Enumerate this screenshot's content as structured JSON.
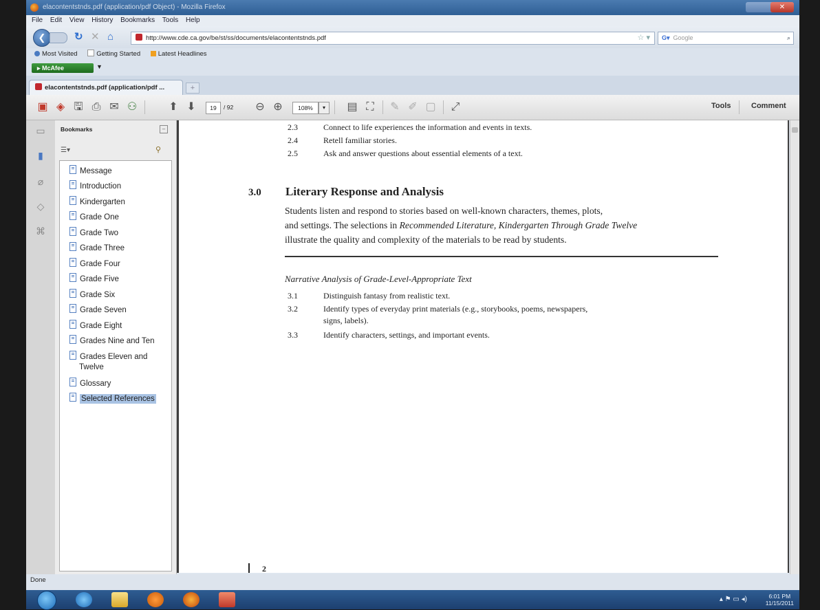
{
  "window": {
    "title": "elacontentstnds.pdf (application/pdf Object) - Mozilla Firefox"
  },
  "menu": [
    "File",
    "Edit",
    "View",
    "History",
    "Bookmarks",
    "Tools",
    "Help"
  ],
  "nav": {
    "url": "http://www.cde.ca.gov/be/st/ss/documents/elacontentstnds.pdf",
    "search_placeholder": "Google"
  },
  "bookmarks_bar": [
    "Most Visited",
    "Getting Started",
    "Latest Headlines"
  ],
  "addon": {
    "label": "McAfee"
  },
  "tab": {
    "label": "elacontentstnds.pdf (application/pdf ..."
  },
  "pdf_toolbar": {
    "page_current": "19",
    "page_total": "/ 92",
    "zoom": "108%",
    "tools_label": "Tools",
    "comment_label": "Comment"
  },
  "bookmarks_panel": {
    "title": "Bookmarks",
    "items": [
      "Message",
      "Introduction",
      "Kindergarten",
      "Grade One",
      "Grade Two",
      "Grade Three",
      "Grade Four",
      "Grade Five",
      "Grade Six",
      "Grade Seven",
      "Grade Eight",
      "Grades Nine and Ten",
      "Grades Eleven and",
      "Twelve",
      "Glossary",
      "Selected References"
    ],
    "selected": "Selected References"
  },
  "document": {
    "top_items": [
      {
        "num": "2.3",
        "text": "Connect to life experiences the information and events in texts."
      },
      {
        "num": "2.4",
        "text": "Retell familiar stories."
      },
      {
        "num": "2.5",
        "text": "Ask and answer questions about essential elements of a text."
      }
    ],
    "section_number": "3.0",
    "section_title": "Literary Response and Analysis",
    "section_body_1": "Students listen and respond to stories based on well-known characters, themes, plots,",
    "section_body_2a": "and settings. The selections in ",
    "section_body_2b": "Recommended Literature, Kindergarten Through Grade Twelve",
    "section_body_3": "illustrate the quality and complexity of the materials to be read by students.",
    "subheading": "Narrative Analysis of Grade-Level-Appropriate Text",
    "items": [
      {
        "num": "3.1",
        "text": "Distinguish fantasy from realistic text."
      },
      {
        "num": "3.2",
        "text": "Identify types of everyday print materials (e.g., storybooks, poems, newspapers,"
      },
      {
        "num": "",
        "text": "signs, labels)."
      },
      {
        "num": "3.3",
        "text": "Identify characters, settings, and important events."
      }
    ],
    "page_number": "2"
  },
  "status": {
    "text": "Done"
  },
  "clock": {
    "time": "6:01 PM",
    "date": "11/15/2011"
  }
}
